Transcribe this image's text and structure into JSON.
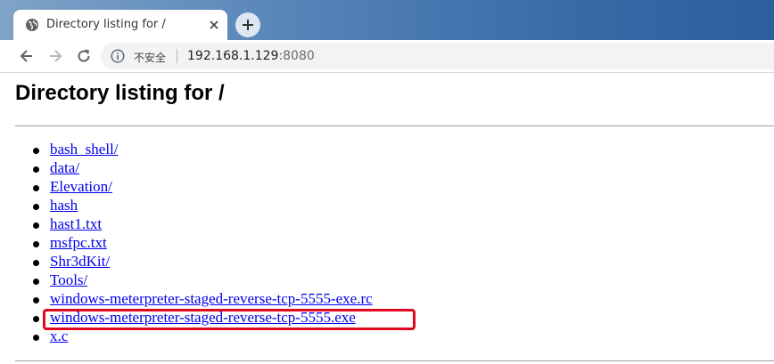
{
  "browser": {
    "tab": {
      "title": "Directory listing for /"
    },
    "address_bar": {
      "security_label": "不安全",
      "url_host": "192.168.1.129",
      "url_port": ":8080"
    }
  },
  "page": {
    "heading": "Directory listing for /",
    "files": [
      {
        "name": "bash_shell/"
      },
      {
        "name": "data/"
      },
      {
        "name": "Elevation/"
      },
      {
        "name": "hash"
      },
      {
        "name": "hast1.txt"
      },
      {
        "name": "msfpc.txt"
      },
      {
        "name": "Shr3dKit/"
      },
      {
        "name": "Tools/"
      },
      {
        "name": "windows-meterpreter-staged-reverse-tcp-5555-exe.rc"
      },
      {
        "name": "windows-meterpreter-staged-reverse-tcp-5555.exe"
      },
      {
        "name": "x.c"
      }
    ],
    "highlighted_file_index": 9,
    "highlight_color": "#e0081f",
    "link_color": "#0000ee"
  }
}
